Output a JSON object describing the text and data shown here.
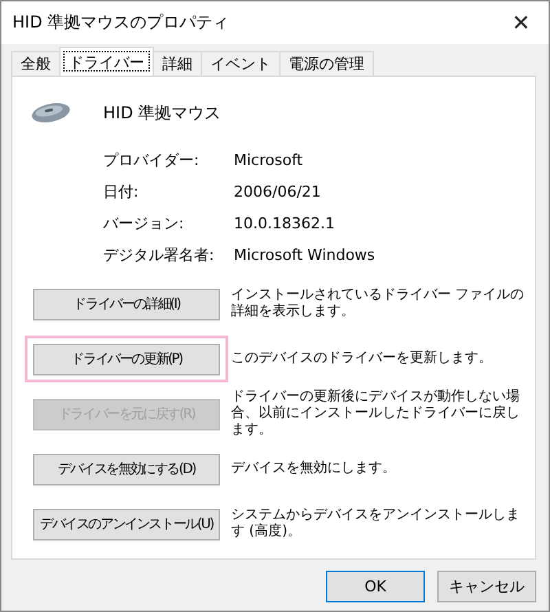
{
  "window": {
    "title": "HID 準拠マウスのプロパティ",
    "close": "✕"
  },
  "tabs": [
    {
      "label": "全般",
      "selected": false
    },
    {
      "label": "ドライバー",
      "selected": true
    },
    {
      "label": "詳細",
      "selected": false
    },
    {
      "label": "イベント",
      "selected": false
    },
    {
      "label": "電源の管理",
      "selected": false
    }
  ],
  "device": {
    "name": "HID 準拠マウス"
  },
  "properties": [
    {
      "label": "プロバイダー:",
      "value": "Microsoft"
    },
    {
      "label": "日付:",
      "value": "2006/06/21"
    },
    {
      "label": "バージョン:",
      "value": "10.0.18362.1"
    },
    {
      "label": "デジタル署名者:",
      "value": "Microsoft Windows"
    }
  ],
  "actions": [
    {
      "button": "ドライバーの詳細(I)",
      "description": "インストールされているドライバー ファイルの詳細を表示します。",
      "disabled": false,
      "highlighted": false
    },
    {
      "button": "ドライバーの更新(P)",
      "description": "このデバイスのドライバーを更新します。",
      "disabled": false,
      "highlighted": true
    },
    {
      "button": "ドライバーを元に戻す(R)",
      "description": "ドライバーの更新後にデバイスが動作しない場合、以前にインストールしたドライバーに戻します。",
      "disabled": true,
      "highlighted": false
    },
    {
      "button": "デバイスを無効にする(D)",
      "description": "デバイスを無効にします。",
      "disabled": false,
      "highlighted": false
    },
    {
      "button": "デバイスのアンインストール(U)",
      "description": "システムからデバイスをアンインストールします (高度)。",
      "disabled": false,
      "highlighted": false
    }
  ],
  "buttons": [
    {
      "label": "OK",
      "default": true
    },
    {
      "label": "キャンセル",
      "default": false
    }
  ]
}
